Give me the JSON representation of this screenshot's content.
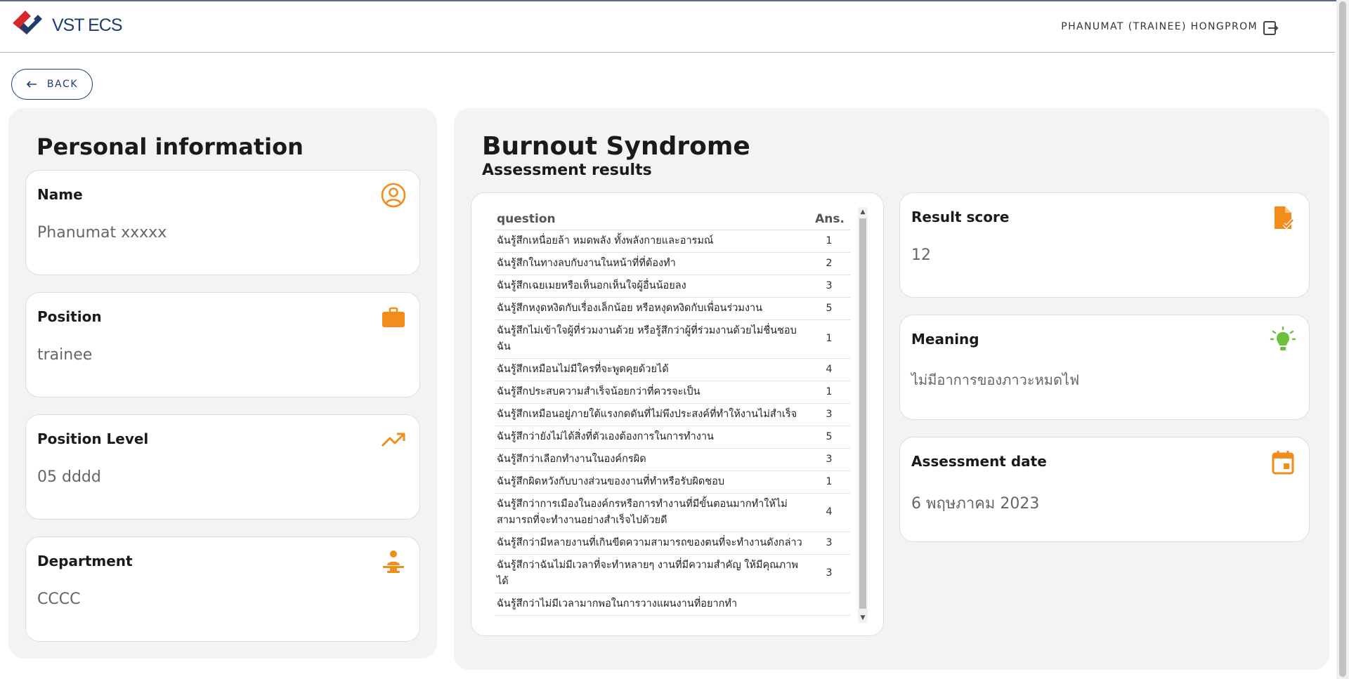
{
  "header": {
    "logo_text": "VST ECS",
    "user_name": "PHANUMAT (TRAINEE) HONGPROM",
    "logout_icon": "logout-icon"
  },
  "back": {
    "label": "BACK",
    "icon": "arrow-left-icon"
  },
  "personal": {
    "title": "Personal information",
    "cards": [
      {
        "label": "Name",
        "value": "Phanumat xxxxx",
        "icon": "user-circle-icon"
      },
      {
        "label": "Position",
        "value": "trainee",
        "icon": "briefcase-icon"
      },
      {
        "label": "Position Level",
        "value": "05 dddd",
        "icon": "trending-up-icon"
      },
      {
        "label": "Department",
        "value": "CCCC",
        "icon": "person-desk-icon"
      }
    ]
  },
  "assessment": {
    "title": "Burnout Syndrome",
    "subtitle": "Assessment results",
    "table": {
      "col_question": "question",
      "col_ans": "Ans.",
      "rows": [
        {
          "q": "ฉันรู้สึกเหนื่อยล้า หมดพลัง ทั้งพลังกายและอารมณ์",
          "a": "1"
        },
        {
          "q": "ฉันรู้สึกในทางลบกับงานในหน้าที่ที่ต้องทำ",
          "a": "2"
        },
        {
          "q": "ฉันรู้สึกเฉยเมยหรือเห็นอกเห็นใจผู้อื่นน้อยลง",
          "a": "3"
        },
        {
          "q": "ฉันรู้สึกหงุดหงิดกับเรื่องเล็กน้อย หรือหงุดหงิดกับเพื่อนร่วมงาน",
          "a": "5"
        },
        {
          "q": "ฉันรู้สึกไม่เข้าใจผู้ที่ร่วมงานด้วย หรือรู้สึกว่าผู้ที่ร่วมงานด้วยไม่ชื่นชอบฉัน",
          "a": "1"
        },
        {
          "q": "ฉันรู้สึกเหมือนไม่มีใครที่จะพูดคุยด้วยได้",
          "a": "4"
        },
        {
          "q": "ฉันรู้สึกประสบความสำเร็จน้อยกว่าที่ควรจะเป็น",
          "a": "1"
        },
        {
          "q": "ฉันรู้สึกเหมือนอยู่ภายใต้แรงกดดันที่ไม่พึงประสงค์ที่ทำให้งานไม่สำเร็จ",
          "a": "3"
        },
        {
          "q": "ฉันรู้สึกว่ายังไม่ได้สิ่งที่ตัวเองต้องการในการทำงาน",
          "a": "5"
        },
        {
          "q": "ฉันรู้สึกว่าเลือกทำงานในองค์กรผิด",
          "a": "3"
        },
        {
          "q": "ฉันรู้สึกผิดหวังกับบางส่วนของงานที่ทำหรือรับผิดชอบ",
          "a": "1"
        },
        {
          "q": "ฉันรู้สึกว่าการเมืองในองค์กรหรือการทำงานที่มีขั้นตอนมากทำให้ไม่สามารถที่จะทำงานอย่างสำเร็จไปด้วยดี",
          "a": "4"
        },
        {
          "q": "ฉันรู้สึกว่ามีหลายงานที่เกินขีดความสามารถของตนที่จะทำงานดังกล่าว",
          "a": "3"
        },
        {
          "q": "ฉันรู้สึกว่าฉันไม่มีเวลาที่จะทำหลายๆ งานที่มีความสำคัญ ให้มีคุณภาพได้",
          "a": "3"
        },
        {
          "q": "ฉันรู้สึกว่าไม่มีเวลามากพอในการวางแผนงานที่อยากทำ",
          "a": ""
        }
      ]
    },
    "cards": [
      {
        "label": "Result score",
        "value": "12",
        "icon": "file-check-icon",
        "color": "#f28c1b"
      },
      {
        "label": "Meaning",
        "value": "ไม่มีอาการของภาวะหมดไฟ",
        "icon": "lightbulb-icon",
        "color": "#6cbf3b"
      },
      {
        "label": "Assessment date",
        "value": "6 พฤษภาคม 2023",
        "icon": "calendar-icon",
        "color": "#f28c1b"
      }
    ]
  },
  "colors": {
    "accent_orange": "#f28c1b",
    "accent_green": "#6cbf3b",
    "brand_navy": "#1d3d6e",
    "brand_red": "#d6282c"
  }
}
